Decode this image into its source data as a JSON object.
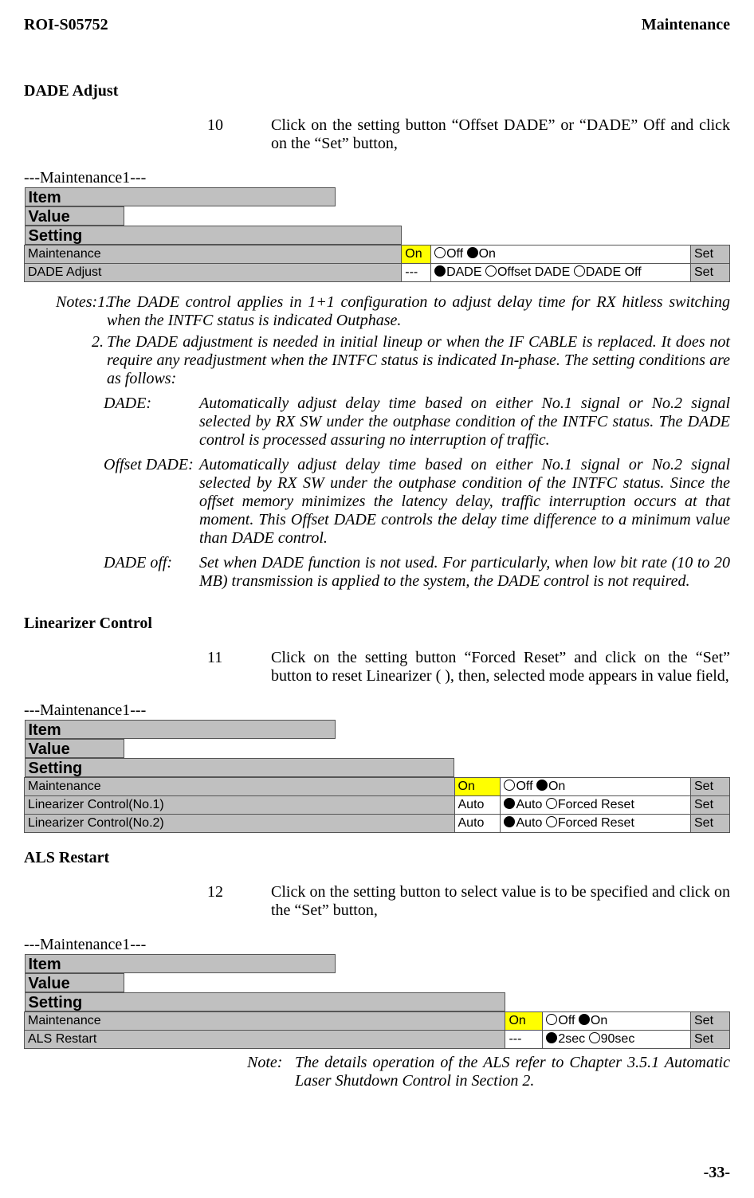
{
  "header": {
    "left": "ROI-S05752",
    "right": "Maintenance"
  },
  "dade": {
    "title": "DADE Adjust",
    "step_num": "10",
    "step_text": "Click on the setting button “Offset DADE” or “DADE” Off and click on the “Set” button,",
    "table_title": "---Maintenance1---",
    "table": {
      "hdr_item": "Item",
      "hdr_value": "Value",
      "hdr_setting": "Setting",
      "rows": [
        {
          "item": "Maintenance",
          "value": "On",
          "value_on": true,
          "setting_parts": [
            {
              "filled": false,
              "text": "Off "
            },
            {
              "filled": true,
              "text": "On"
            }
          ],
          "set": "Set"
        },
        {
          "item": "DADE Adjust",
          "value": "---",
          "value_on": false,
          "setting_parts": [
            {
              "filled": true,
              "text": "DADE "
            },
            {
              "filled": false,
              "text": "Offset DADE "
            },
            {
              "filled": false,
              "text": "DADE Off"
            }
          ],
          "set": "Set"
        }
      ]
    },
    "notes_label1": "Notes:1.",
    "notes_text1": "The DADE control applies in 1+1 configuration to adjust delay time for RX hitless switching when the INTFC status is indicated Outphase.",
    "notes_label2": "2.",
    "notes_text2": "The DADE adjustment is needed in initial lineup or when the IF CABLE is replaced. It does not require any readjustment when the INTFC status is indicated In-phase. The setting conditions are as follows:",
    "defs": [
      {
        "label": "DADE:",
        "text": "Automatically adjust delay time based on either No.1 signal or No.2 signal selected by RX SW under the outphase condition of the INTFC status. The DADE control is processed assuring no interruption of traffic."
      },
      {
        "label": "Offset DADE:",
        "text": "Automatically adjust delay time based on either No.1 signal or No.2 signal selected by RX SW under the outphase condition of the INTFC status. Since the offset memory minimizes the latency delay, traffic interruption occurs at that moment. This Offset DADE controls the delay time difference to a minimum value than DADE control."
      },
      {
        "label": "DADE off:",
        "text": "Set when DADE function is not used. For particularly, when low bit rate (10 to 20 MB) transmission is applied to the system, the DADE control is not required."
      }
    ]
  },
  "linearizer": {
    "title": "Linearizer Control",
    "step_num": "11",
    "step_text": "Click on the setting button “Forced Reset” and click on the “Set” button to reset Linearizer ( ), then, selected mode appears in value field,",
    "table_title": "---Maintenance1---",
    "table": {
      "hdr_item": "Item",
      "hdr_value": "Value",
      "hdr_setting": "Setting",
      "rows": [
        {
          "item": "Maintenance",
          "value": "On",
          "value_on": true,
          "setting_parts": [
            {
              "filled": false,
              "text": "Off "
            },
            {
              "filled": true,
              "text": "On"
            }
          ],
          "set": "Set"
        },
        {
          "item": "Linearizer Control(No.1)",
          "value": "Auto",
          "value_on": false,
          "setting_parts": [
            {
              "filled": true,
              "text": "Auto "
            },
            {
              "filled": false,
              "text": "Forced Reset"
            }
          ],
          "set": "Set"
        },
        {
          "item": "Linearizer Control(No.2)",
          "value": "Auto",
          "value_on": false,
          "setting_parts": [
            {
              "filled": true,
              "text": "Auto "
            },
            {
              "filled": false,
              "text": "Forced Reset"
            }
          ],
          "set": "Set"
        }
      ]
    }
  },
  "als": {
    "title": "ALS Restart",
    "step_num": "12",
    "step_text": "Click on the setting button to select value is to be specified and click on the “Set” button,",
    "table_title": "---Maintenance1---",
    "table": {
      "hdr_item": "Item",
      "hdr_value": "Value",
      "hdr_setting": "Setting",
      "rows": [
        {
          "item": "Maintenance",
          "value": "On",
          "value_on": true,
          "setting_parts": [
            {
              "filled": false,
              "text": "Off "
            },
            {
              "filled": true,
              "text": "On"
            }
          ],
          "set": "Set"
        },
        {
          "item": "ALS Restart",
          "value": "---",
          "value_on": false,
          "setting_parts": [
            {
              "filled": true,
              "text": "2sec "
            },
            {
              "filled": false,
              "text": "90sec"
            }
          ],
          "set": "Set"
        }
      ]
    },
    "note_label": "Note:",
    "note_text": "The details operation of the ALS refer to Chapter 3.5.1 Automatic Laser Shutdown Control in Section 2."
  },
  "page_number": "-33-"
}
